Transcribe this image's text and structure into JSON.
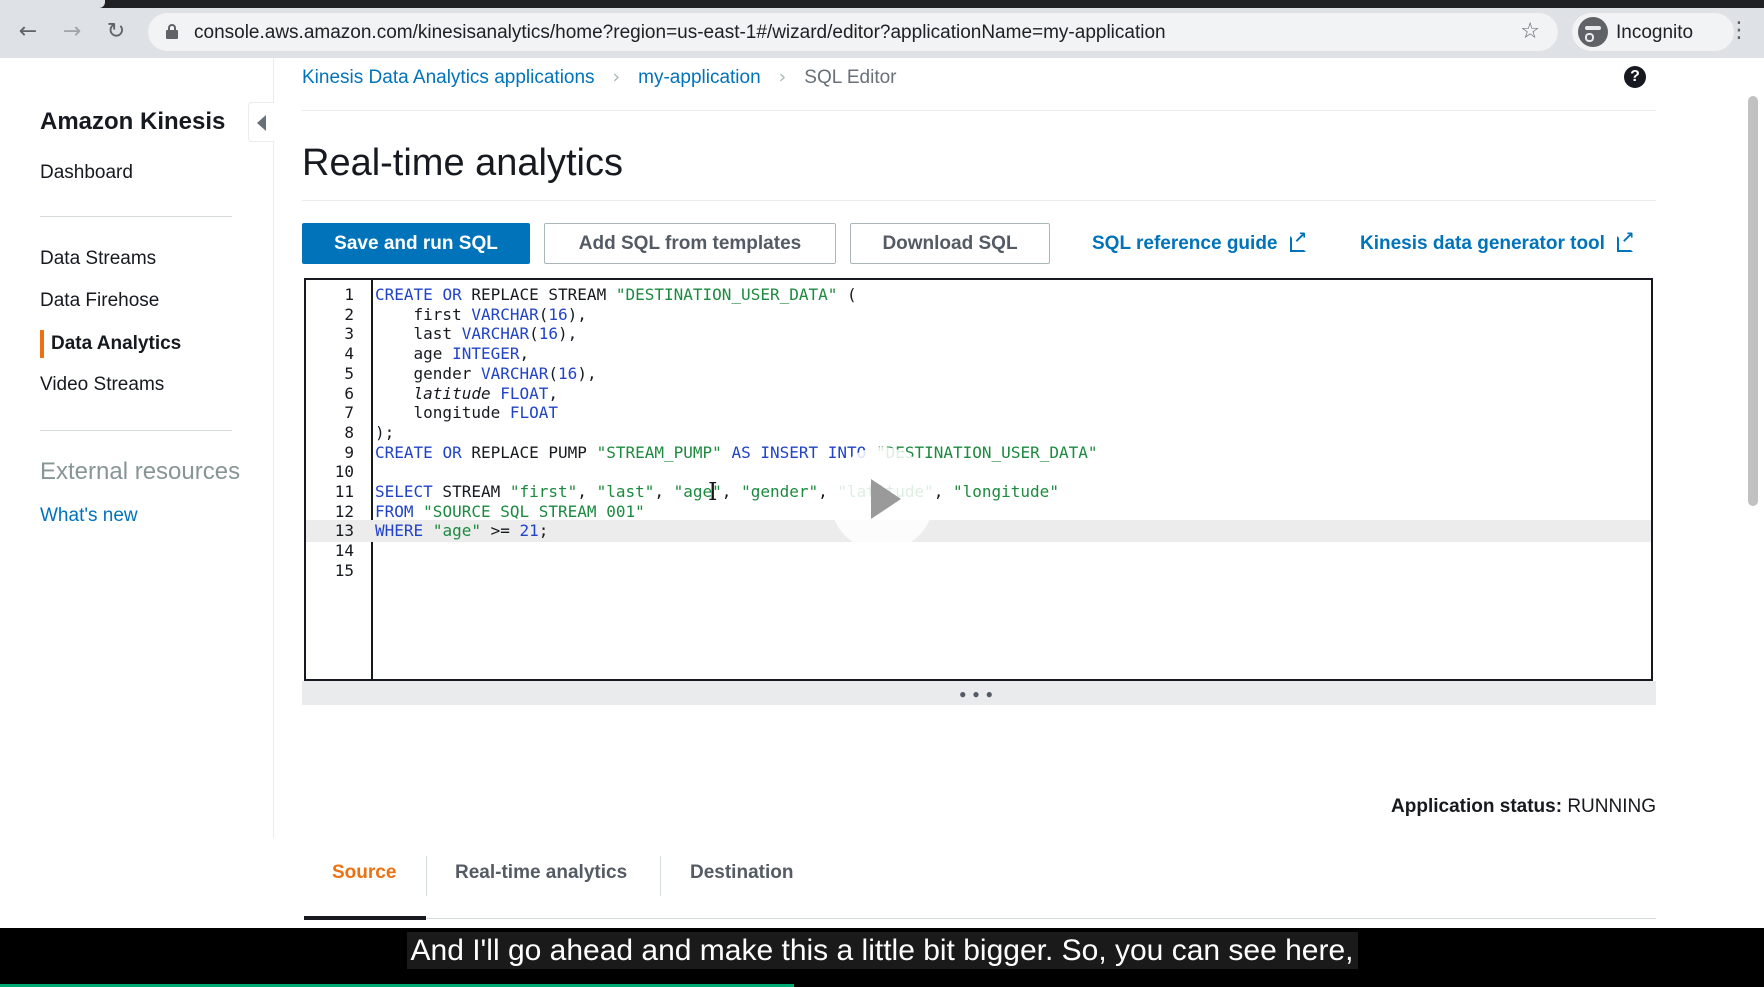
{
  "browser": {
    "url": "console.aws.amazon.com/kinesisanalytics/home?region=us-east-1#/wizard/editor?applicationName=my-application",
    "profile_label": "Incognito"
  },
  "sidebar": {
    "title": "Amazon Kinesis",
    "dashboard": "Dashboard",
    "items": [
      {
        "label": "Data Streams"
      },
      {
        "label": "Data Firehose"
      },
      {
        "label": "Data Analytics"
      },
      {
        "label": "Video Streams"
      }
    ],
    "active_item": "Data Analytics",
    "section_title": "External resources",
    "whats_new": "What's new"
  },
  "breadcrumb": {
    "items": [
      "Kinesis Data Analytics applications",
      "my-application",
      "SQL Editor"
    ]
  },
  "page": {
    "title": "Real-time analytics"
  },
  "toolbar": {
    "save_run": "Save and run SQL",
    "add_templates": "Add SQL from templates",
    "download": "Download SQL",
    "reference_guide": "SQL reference guide",
    "data_generator": "Kinesis data generator tool"
  },
  "editor": {
    "highlighted_line": 13,
    "line_numbers": [
      "1",
      "2",
      "3",
      "4",
      "5",
      "6",
      "7",
      "8",
      "9",
      "10",
      "11",
      "12",
      "13",
      "14",
      "15"
    ],
    "lines": [
      "CREATE OR REPLACE STREAM \"DESTINATION_USER_DATA\" (",
      "    first VARCHAR(16),",
      "    last VARCHAR(16),",
      "    age INTEGER,",
      "    gender VARCHAR(16),",
      "    latitude FLOAT,",
      "    longitude FLOAT",
      ");",
      "CREATE OR REPLACE PUMP \"STREAM_PUMP\" AS INSERT INTO \"DESTINATION_USER_DATA\"",
      "",
      "SELECT STREAM \"first\", \"last\", \"age\", \"gender\", \"latitude\", \"longitude\"",
      "FROM \"SOURCE_SQL_STREAM_001\"",
      "WHERE \"age\" >= 21;",
      "",
      ""
    ]
  },
  "status": {
    "label": "Application status:",
    "value": "RUNNING"
  },
  "tabs": [
    {
      "label": "Source",
      "active": true
    },
    {
      "label": "Real-time analytics",
      "active": false
    },
    {
      "label": "Destination",
      "active": false
    }
  ],
  "video": {
    "caption": "And I'll go ahead and make this a little bit bigger. So, you can see here,",
    "progress": 0.45
  },
  "colors": {
    "primary": "#0073bb",
    "accent": "#ec7211",
    "keyword": "#2143c7",
    "string": "#1c8a3f"
  }
}
